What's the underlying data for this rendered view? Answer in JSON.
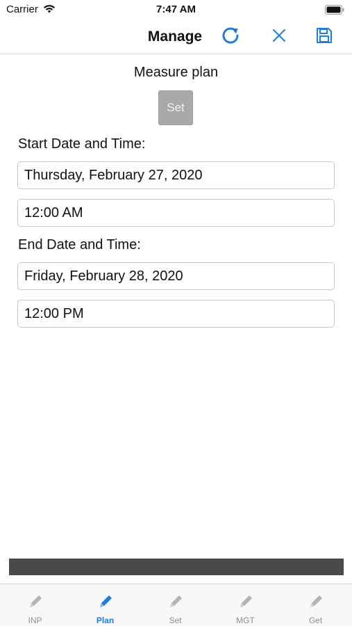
{
  "status_bar": {
    "carrier": "Carrier",
    "time": "7:47 AM"
  },
  "nav": {
    "title": "Manage",
    "refresh_icon": "refresh-icon",
    "close_icon": "close-icon",
    "save_icon": "save-icon",
    "accent": "#1e7ce0"
  },
  "main": {
    "section_title": "Measure plan",
    "set_button": "Set",
    "start_label": "Start Date and Time:",
    "start_date": "Thursday, February 27, 2020",
    "start_time": "12:00 AM",
    "end_label": "End Date and Time:",
    "end_date": "Friday, February 28, 2020",
    "end_time": "12:00 PM"
  },
  "tabs": [
    {
      "label": "INP",
      "icon": "pencil-icon",
      "active": false
    },
    {
      "label": "Plan",
      "icon": "pencil-icon",
      "active": true
    },
    {
      "label": "Set",
      "icon": "pencil-icon",
      "active": false
    },
    {
      "label": "MGT",
      "icon": "pencil-icon",
      "active": false
    },
    {
      "label": "Get",
      "icon": "pencil-icon",
      "active": false
    }
  ]
}
